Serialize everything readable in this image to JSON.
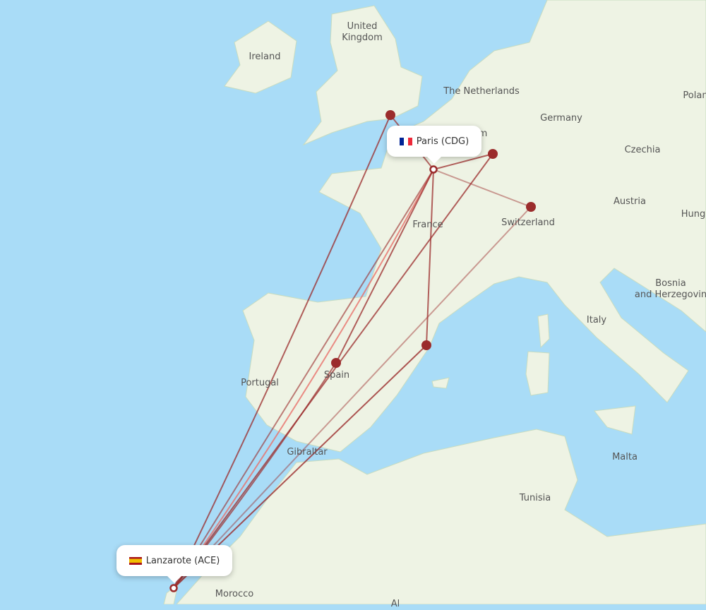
{
  "origin": {
    "city": "Lanzarote (ACE)",
    "flag": "es"
  },
  "hub": {
    "city": "Paris (CDG)",
    "flag": "fr"
  },
  "colors": {
    "sea": "#a9dcf7",
    "land": "#eef3e4",
    "route": "#9b2c2c",
    "route_light": "#e8706a",
    "marker": "#9b2c2c"
  },
  "labels": [
    {
      "text": "United\nKingdom"
    },
    {
      "text": "Ireland"
    },
    {
      "text": "The Netherlands"
    },
    {
      "text": "Germany"
    },
    {
      "text": "Czechia"
    },
    {
      "text": "Polan"
    },
    {
      "text": "Austria"
    },
    {
      "text": "Hung"
    },
    {
      "text": "Switzerland"
    },
    {
      "text": "France"
    },
    {
      "text": "Bosnia\nand Herzegovin"
    },
    {
      "text": "Italy"
    },
    {
      "text": "Portugal"
    },
    {
      "text": "Spain"
    },
    {
      "text": "Gibraltar"
    },
    {
      "text": "Malta"
    },
    {
      "text": "Tunisia"
    },
    {
      "text": "Morocco"
    },
    {
      "text": "m"
    },
    {
      "text": "Al"
    }
  ],
  "destinations": [
    "London",
    "Paris (CDG)",
    "Düsseldorf",
    "Basel",
    "Barcelona",
    "Madrid"
  ]
}
